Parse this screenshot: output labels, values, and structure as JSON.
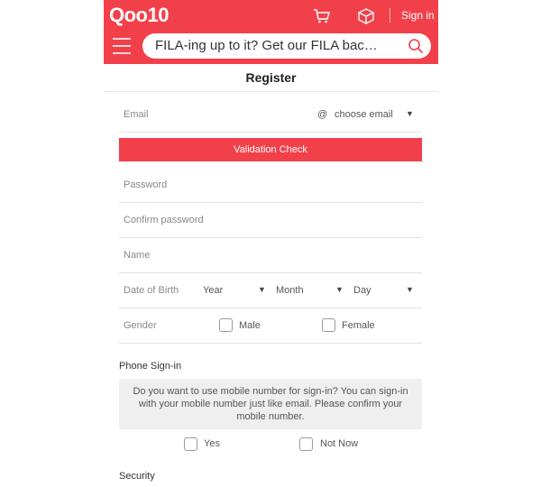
{
  "header": {
    "logo": "Qoo10",
    "signin": "Sign in",
    "search_text": "FILA-ing up to it? Get our FILA backpa..."
  },
  "page": {
    "title": "Register"
  },
  "form": {
    "email_placeholder": "Email",
    "at_symbol": "@",
    "email_domain": "choose email",
    "validation_button": "Validation Check",
    "password_placeholder": "Password",
    "confirm_password_placeholder": "Confirm password",
    "name_placeholder": "Name",
    "dob_label": "Date of Birth",
    "dob_year": "Year",
    "dob_month": "Month",
    "dob_day": "Day",
    "gender_label": "Gender",
    "gender_male": "Male",
    "gender_female": "Female"
  },
  "phone_signin": {
    "title": "Phone Sign-in",
    "notice": "Do you want to use mobile number for sign-in?  You can sign-in with your mobile number just like email. Please confirm your mobile number.",
    "yes": "Yes",
    "no": "Not Now"
  },
  "security": {
    "title": "Security"
  },
  "colors": {
    "brand": "#f2404b",
    "notice_bg": "#efefef"
  },
  "icons": [
    "cart-icon",
    "box-icon",
    "menu-icon",
    "search-icon",
    "dropdown-arrow-icon"
  ]
}
